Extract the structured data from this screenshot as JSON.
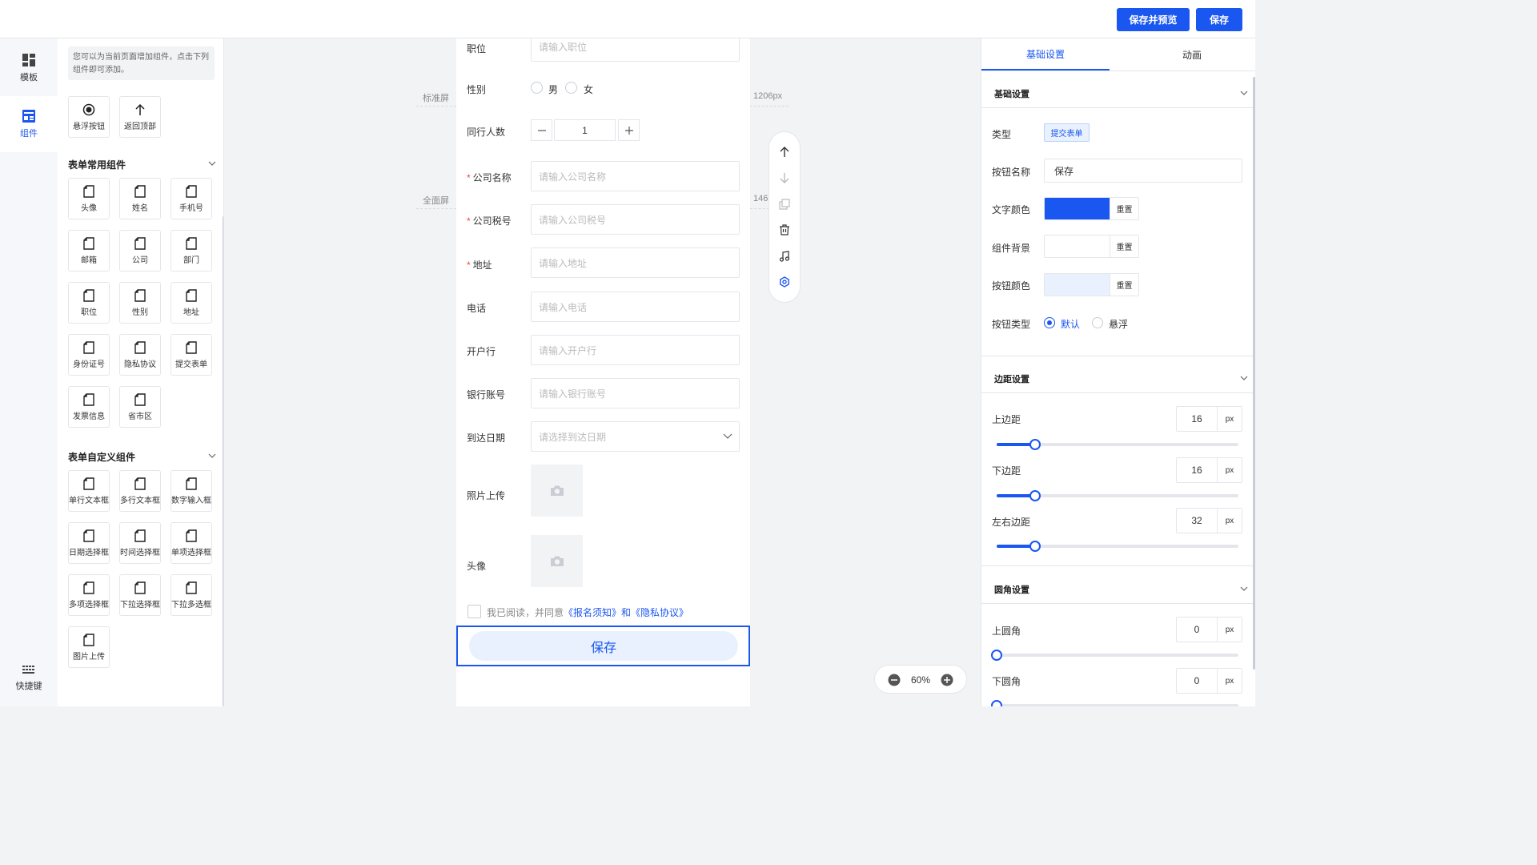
{
  "header": {
    "save_preview_label": "保存并预览",
    "save_label": "保存"
  },
  "leftnav": {
    "items": [
      {
        "label": "模板",
        "icon": "dashboard-icon"
      },
      {
        "label": "组件",
        "icon": "components-icon"
      }
    ],
    "shortcut_label": "快捷键"
  },
  "panel": {
    "tip": "您可以为当前页面增加组件，点击下列组件即可添加。",
    "top_items": [
      "悬浮按钮",
      "返回顶部"
    ],
    "common_title": "表单常用组件",
    "common_items": [
      "头像",
      "姓名",
      "手机号",
      "邮箱",
      "公司",
      "部门",
      "职位",
      "性别",
      "地址",
      "身份证号",
      "隐私协议",
      "提交表单",
      "发票信息",
      "省市区"
    ],
    "custom_title": "表单自定义组件",
    "custom_items": [
      "单行文本框",
      "多行文本框",
      "数字输入框",
      "日期选择框",
      "时间选择框",
      "单项选择框",
      "多项选择框",
      "下拉选择框",
      "下拉多选框",
      "图片上传"
    ]
  },
  "canvas": {
    "guide_standard": "标准屏",
    "guide_standard_px": "1206px",
    "guide_full": "全面屏",
    "guide_full_px": "146",
    "form": {
      "position_label": "职位",
      "position_placeholder": "请输入职位",
      "gender_label": "性别",
      "gender_male": "男",
      "gender_female": "女",
      "companions_label": "同行人数",
      "companions_value": "1",
      "company_label": "公司名称",
      "company_placeholder": "请输入公司名称",
      "tax_label": "公司税号",
      "tax_placeholder": "请输入公司税号",
      "address_label": "地址",
      "address_placeholder": "请输入地址",
      "phone_label": "电话",
      "phone_placeholder": "请输入电话",
      "bank_label": "开户行",
      "bank_placeholder": "请输入开户行",
      "account_label": "银行账号",
      "account_placeholder": "请输入银行账号",
      "arrival_label": "到达日期",
      "arrival_placeholder": "请选择到达日期",
      "photo_label": "照片上传",
      "avatar_label": "头像",
      "agree_prefix": "我已阅读，并同意",
      "agree_links": "《报名须知》和《隐私协议》",
      "save_button": "保存"
    },
    "zoom": "60%"
  },
  "rpanel": {
    "tabs": [
      "基础设置",
      "动画"
    ],
    "basic_title": "基础设置",
    "type_label": "类型",
    "type_value": "提交表单",
    "name_label": "按钮名称",
    "name_value": "保存",
    "text_color_label": "文字颜色",
    "text_color": "#1a56f0",
    "bg_label": "组件背景",
    "bg_color": "#ffffff",
    "btn_color_label": "按钮颜色",
    "btn_color": "#e8f1fd",
    "reset": "重置",
    "btn_type_label": "按钮类型",
    "btn_type_default": "默认",
    "btn_type_float": "悬浮",
    "margin_title": "边距设置",
    "top_margin_label": "上边距",
    "top_margin": "16",
    "bottom_margin_label": "下边距",
    "bottom_margin": "16",
    "side_margin_label": "左右边距",
    "side_margin": "32",
    "unit": "px",
    "radius_title": "圆角设置",
    "top_radius_label": "上圆角",
    "top_radius": "0",
    "bottom_radius_label": "下圆角",
    "bottom_radius": "0"
  },
  "colors": {
    "accent": "#1a56f0",
    "required": "#f53f3f"
  }
}
